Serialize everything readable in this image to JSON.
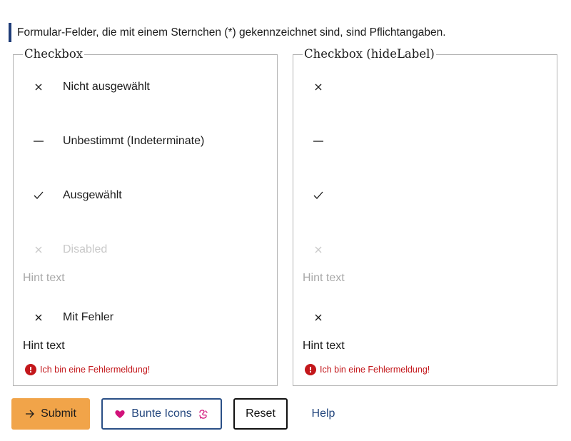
{
  "notice": "Formular-Felder, die mit einem Sternchen (*) gekennzeichnet sind, sind Pflichtangaben.",
  "groups": [
    {
      "legend": "Checkbox",
      "items": [
        {
          "label": "Nicht ausgewählt",
          "state": "unchecked",
          "icon": "cross-icon"
        },
        {
          "label": "Unbestimmt (Indeterminate)",
          "state": "indeterminate",
          "icon": "dash-icon"
        },
        {
          "label": "Ausgewählt",
          "state": "checked",
          "icon": "check-icon"
        },
        {
          "label": "Disabled",
          "state": "disabled",
          "icon": "cross-icon"
        }
      ],
      "disabled_hint": "Hint text",
      "error_item": {
        "label": "Mit Fehler",
        "state": "unchecked",
        "icon": "cross-icon"
      },
      "error_hint": "Hint text",
      "error_message": "Ich bin eine Fehlermeldung!"
    },
    {
      "legend": "Checkbox (hideLabel)",
      "items": [
        {
          "label": "",
          "state": "unchecked",
          "icon": "cross-icon"
        },
        {
          "label": "",
          "state": "indeterminate",
          "icon": "dash-icon"
        },
        {
          "label": "",
          "state": "checked",
          "icon": "check-icon"
        },
        {
          "label": "",
          "state": "disabled",
          "icon": "cross-icon"
        }
      ],
      "disabled_hint": "Hint text",
      "error_item": {
        "label": "",
        "state": "unchecked",
        "icon": "cross-icon"
      },
      "error_hint": "Hint text",
      "error_message": "Ich bin eine Fehlermeldung!"
    }
  ],
  "buttons": {
    "submit": "Submit",
    "icons": "Bunte Icons",
    "reset": "Reset",
    "help": "Help"
  },
  "colors": {
    "accent": "#1f3c78",
    "submit_bg": "#f1a449",
    "error": "#c3171b",
    "heart": "#d1127a",
    "link": "#23467d"
  }
}
